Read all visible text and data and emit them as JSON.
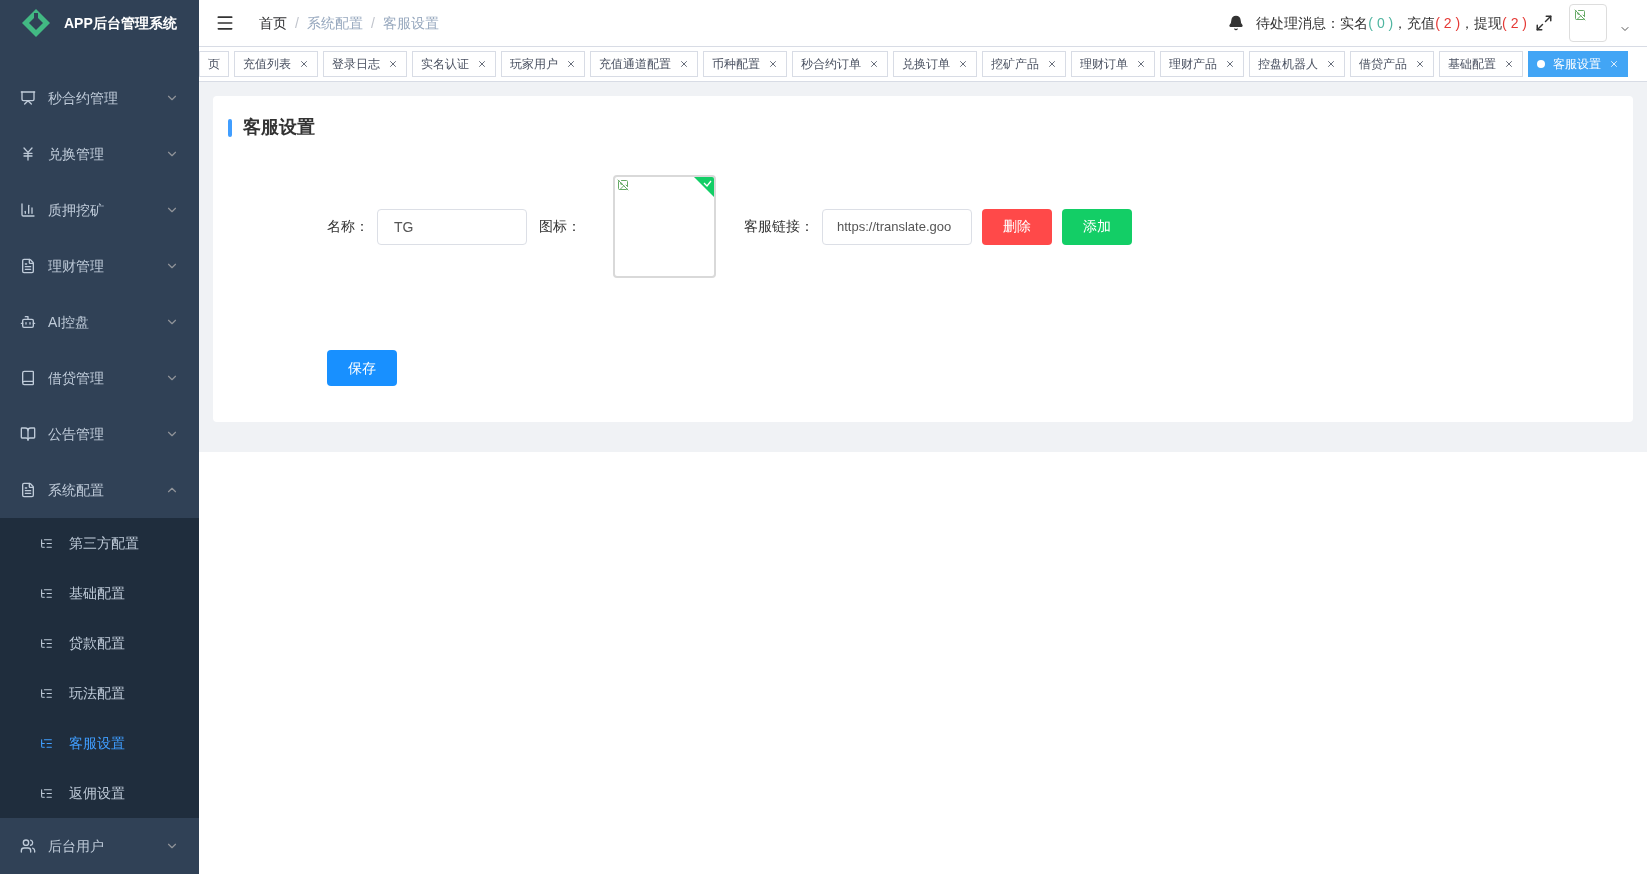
{
  "sidebar": {
    "title": "APP后台管理系统",
    "items": [
      {
        "label": "秒合约管理",
        "expanded": false
      },
      {
        "label": "兑换管理",
        "expanded": false
      },
      {
        "label": "质押挖矿",
        "expanded": false
      },
      {
        "label": "理财管理",
        "expanded": false
      },
      {
        "label": "AI控盘",
        "expanded": false
      },
      {
        "label": "借贷管理",
        "expanded": false
      },
      {
        "label": "公告管理",
        "expanded": false
      },
      {
        "label": "系统配置",
        "expanded": true,
        "children": [
          {
            "label": "第三方配置",
            "selected": false
          },
          {
            "label": "基础配置",
            "selected": false
          },
          {
            "label": "贷款配置",
            "selected": false
          },
          {
            "label": "玩法配置",
            "selected": false
          },
          {
            "label": "客服设置",
            "selected": true
          },
          {
            "label": "返佣设置",
            "selected": false
          }
        ]
      },
      {
        "label": "后台用户",
        "expanded": false
      }
    ]
  },
  "header": {
    "breadcrumb": {
      "items": [
        "首页",
        "系统配置",
        "客服设置"
      ],
      "separator": "/"
    },
    "notice": {
      "label": "待处理消息：",
      "items": [
        {
          "name": "实名",
          "count": "( 0 )",
          "color": "#4fb5a0",
          "sep": "，"
        },
        {
          "name": "充值",
          "count": "( 2 )",
          "color": "#e53935",
          "sep": "，"
        },
        {
          "name": "提现",
          "count": "( 2 )",
          "color": "#e53935"
        }
      ]
    }
  },
  "tabs": [
    {
      "label": "页",
      "selected": false
    },
    {
      "label": "充值列表",
      "selected": false
    },
    {
      "label": "登录日志",
      "selected": false
    },
    {
      "label": "实名认证",
      "selected": false
    },
    {
      "label": "玩家用户",
      "selected": false
    },
    {
      "label": "充值通道配置",
      "selected": false
    },
    {
      "label": "币种配置",
      "selected": false
    },
    {
      "label": "秒合约订单",
      "selected": false
    },
    {
      "label": "兑换订单",
      "selected": false
    },
    {
      "label": "挖矿产品",
      "selected": false
    },
    {
      "label": "理财订单",
      "selected": false
    },
    {
      "label": "理财产品",
      "selected": false
    },
    {
      "label": "控盘机器人",
      "selected": false
    },
    {
      "label": "借贷产品",
      "selected": false
    },
    {
      "label": "基础配置",
      "selected": false
    },
    {
      "label": "客服设置",
      "selected": true
    }
  ],
  "card": {
    "title": "客服设置",
    "rows": [
      {
        "name_label": "名称：",
        "name": "TG",
        "icon_label": "图标：",
        "uploaded": true,
        "link_label": "客服链接：",
        "link": "https://translate.goo",
        "delete": "删除",
        "add": "添加"
      }
    ],
    "save": "保存"
  }
}
